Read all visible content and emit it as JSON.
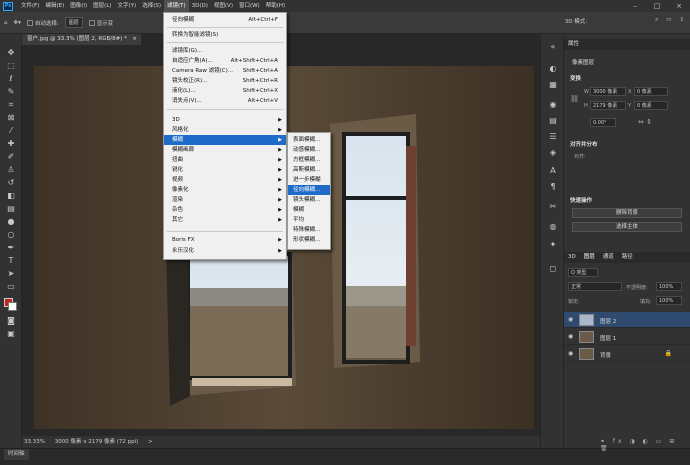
{
  "menubar": {
    "items": [
      "文件(F)",
      "编辑(E)",
      "图像(I)",
      "图层(L)",
      "文字(Y)",
      "选择(S)",
      "滤镜(T)",
      "3D(D)",
      "视图(V)",
      "窗口(W)",
      "帮助(H)"
    ],
    "active_index": 6
  },
  "optbar": {
    "auto_select": "自动选择:",
    "layer_select": "图层",
    "show_transform": "显示变",
    "mode_3d": "3D 模式:"
  },
  "tab": {
    "title": "窗户.jpg @ 33.3% (图层 2, RGB/8#) *",
    "close": "×"
  },
  "filter_menu": {
    "items": [
      {
        "label": "径向模糊",
        "shortcut": "Alt+Ctrl+F"
      },
      {
        "label": "转换为智能滤镜(S)",
        "shortcut": ""
      },
      {
        "label": "滤镜库(G)...",
        "shortcut": ""
      },
      {
        "label": "自适应广角(A)...",
        "shortcut": "Alt+Shift+Ctrl+A"
      },
      {
        "label": "Camera Raw 滤镜(C)...",
        "shortcut": "Shift+Ctrl+A"
      },
      {
        "label": "镜头校正(R)...",
        "shortcut": "Shift+Ctrl+R"
      },
      {
        "label": "液化(L)...",
        "shortcut": "Shift+Ctrl+X"
      },
      {
        "label": "消失点(V)...",
        "shortcut": "Alt+Ctrl+V"
      },
      {
        "label": "3D",
        "shortcut": ""
      },
      {
        "label": "风格化",
        "shortcut": ""
      },
      {
        "label": "模糊",
        "shortcut": ""
      },
      {
        "label": "模糊画廊",
        "shortcut": ""
      },
      {
        "label": "扭曲",
        "shortcut": ""
      },
      {
        "label": "锐化",
        "shortcut": ""
      },
      {
        "label": "视频",
        "shortcut": ""
      },
      {
        "label": "像素化",
        "shortcut": ""
      },
      {
        "label": "渲染",
        "shortcut": ""
      },
      {
        "label": "杂色",
        "shortcut": ""
      },
      {
        "label": "其它",
        "shortcut": ""
      },
      {
        "label": "Boris FX",
        "shortcut": ""
      },
      {
        "label": "永乐汉化",
        "shortcut": ""
      }
    ]
  },
  "blur_submenu": {
    "items": [
      "表面模糊...",
      "动感模糊...",
      "方框模糊...",
      "高斯模糊...",
      "进一步模糊",
      "径向模糊...",
      "镜头模糊...",
      "模糊",
      "平均",
      "特殊模糊...",
      "形状模糊..."
    ]
  },
  "statusbar": {
    "zoom": "33.33%",
    "doc": "3000 像素 x 2179 像素 (72 ppi)",
    "arrow": ">"
  },
  "timeline": {
    "label": "时间轴"
  },
  "properties": {
    "header": "属性",
    "pixel_layer": "像素图层",
    "transform": "变换",
    "w_label": "W",
    "w_value": "3000 像素",
    "x_label": "X",
    "x_value": "0 像素",
    "h_label": "H",
    "h_value": "2179 像素",
    "y_label": "Y",
    "y_value": "0 像素",
    "angle": "0.00°",
    "align": "对齐并分布",
    "align_sub": "对齐:",
    "quick": "快速操作",
    "remove_bg": "删除背景",
    "select_subject": "选择主体"
  },
  "layers": {
    "tabs": [
      "3D",
      "图层",
      "通道",
      "路径"
    ],
    "kind": "Q 类型",
    "blend": "正常",
    "opacity_label": "不透明度:",
    "opacity": "100%",
    "lock_label": "锁定:",
    "fill_label": "填充:",
    "fill": "100%",
    "items": [
      {
        "name": "图层 2",
        "selected": true
      },
      {
        "name": "图层 1",
        "selected": false
      },
      {
        "name": "背景",
        "selected": false
      }
    ]
  },
  "colors": {
    "foreground": "#c0241a",
    "background": "#ffffff",
    "accent": "#1e6cc8"
  }
}
